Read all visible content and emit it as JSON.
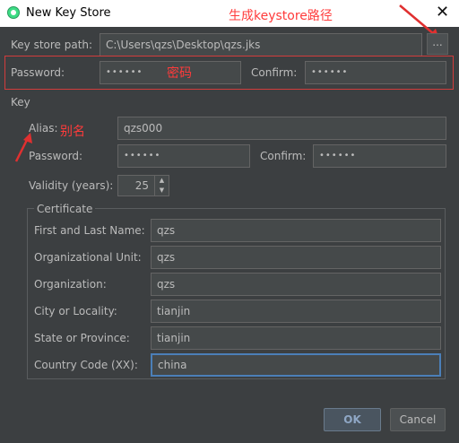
{
  "window": {
    "title": "New Key Store"
  },
  "annotations": {
    "path_note": "生成keystore路径",
    "password_note": "密码",
    "alias_note": "别名",
    "color": "#ff3b3b"
  },
  "keystore": {
    "path_label": "Key store path:",
    "path_value": "C:\\Users\\qzs\\Desktop\\qzs.jks",
    "browse_label": "...",
    "password_label": "Password:",
    "password_value": "••••••",
    "confirm_label": "Confirm:",
    "confirm_value": "••••••"
  },
  "key": {
    "section_label": "Key",
    "alias_label": "Alias:",
    "alias_value": "qzs000",
    "password_label": "Password:",
    "password_value": "••••••",
    "confirm_label": "Confirm:",
    "confirm_value": "••••••",
    "validity_label": "Validity (years):",
    "validity_value": "25"
  },
  "certificate": {
    "section_label": "Certificate",
    "fields": [
      {
        "label": "First and Last Name:",
        "value": "qzs"
      },
      {
        "label": "Organizational Unit:",
        "value": "qzs"
      },
      {
        "label": "Organization:",
        "value": "qzs"
      },
      {
        "label": "City or Locality:",
        "value": "tianjin"
      },
      {
        "label": "State or Province:",
        "value": "tianjin"
      },
      {
        "label": "Country Code (XX):",
        "value": "china"
      }
    ]
  },
  "buttons": {
    "ok": "OK",
    "cancel": "Cancel"
  },
  "icons": {
    "app": "android-studio-icon",
    "close": "close-icon",
    "arrow": "red-arrow-icon"
  }
}
